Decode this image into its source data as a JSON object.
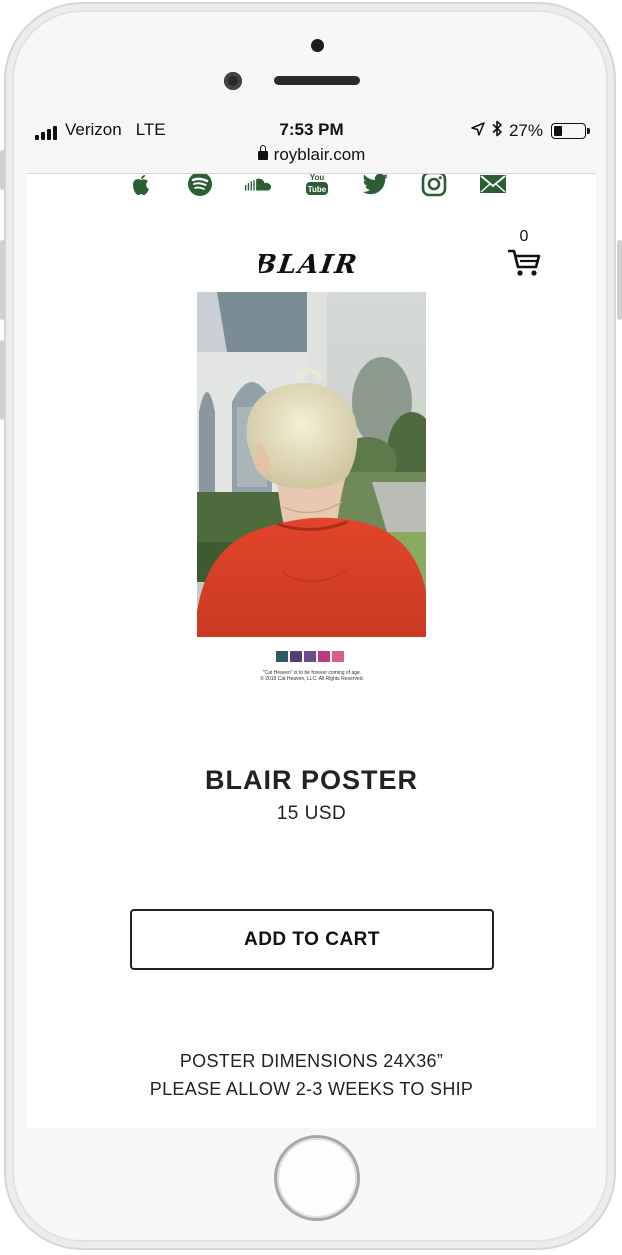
{
  "status_bar": {
    "carrier": "Verizon",
    "network": "LTE",
    "time": "7:53 PM",
    "battery_text": "27%",
    "battery_level": 0.27
  },
  "browser": {
    "url": "royblair.com"
  },
  "social_links": [
    {
      "icon": "apple-music-icon"
    },
    {
      "icon": "spotify-icon"
    },
    {
      "icon": "soundcloud-icon"
    },
    {
      "icon": "youtube-icon",
      "text_top": "You",
      "text_bottom": "Tube"
    },
    {
      "icon": "twitter-icon"
    },
    {
      "icon": "instagram-icon"
    },
    {
      "icon": "mail-icon"
    }
  ],
  "header": {
    "logo_text": "BLAIR",
    "cart_count": "0"
  },
  "poster": {
    "swatch_colors": [
      "#2f5a66",
      "#5b3a6e",
      "#6a4d8c",
      "#b83d7a",
      "#d9607c"
    ],
    "caption_line1": "“Cat Heaven” is to be forever coming of age.",
    "caption_line2": "© 2018 Cat Heaven, LLC. All Rights Reserved."
  },
  "product": {
    "title": "BLAIR POSTER",
    "price": "15 USD",
    "add_to_cart_label": "ADD TO CART",
    "description_line1": "POSTER DIMENSIONS 24X36”",
    "description_line2": "PLEASE ALLOW 2-3 WEEKS TO SHIP"
  },
  "colors": {
    "social_green": "#2c5e34",
    "text": "#222222"
  }
}
